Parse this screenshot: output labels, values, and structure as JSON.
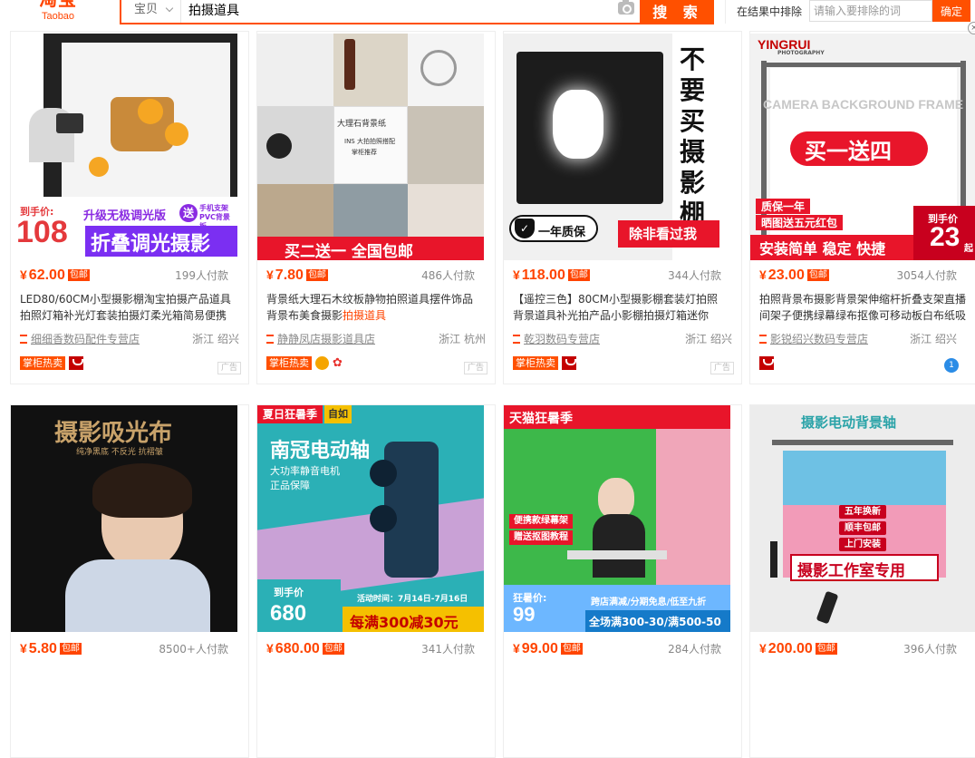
{
  "header": {
    "logo_cn": "淘宝",
    "logo_en": "Taobao",
    "search_category": "宝贝",
    "search_value": "拍摄道具",
    "search_button": "搜 索",
    "exclude_label": "在结果中排除",
    "exclude_placeholder": "请输入要排除的词",
    "exclude_button": "确定"
  },
  "products": [
    {
      "price": "62.00",
      "baoyou": "包邮",
      "deals": "199人付款",
      "title_a": "LED80/60CM小型摄影棚淘宝拍摄产品道具拍照灯箱补光灯套装拍摄灯柔光箱简易便携",
      "title_hl": "",
      "title_b": "",
      "shop": "细细香数码配件专营店",
      "location": "浙江 绍兴",
      "hot_tag": "掌柜热卖",
      "ad": "广告",
      "overlay": {
        "badge": "到手价:",
        "big": "108",
        "upgrade": "升级无极调光版",
        "song": "送",
        "song_sub": "手机支架 PVC背景板",
        "main": "折叠调光摄影"
      }
    },
    {
      "price": "7.80",
      "baoyou": "包邮",
      "deals": "486人付款",
      "title_a": "背景纸大理石木纹板静物拍照道具摆件饰品背景布美食摄影",
      "title_hl": "拍摄道具",
      "title_b": "",
      "shop": "静静凤店摄影道具店",
      "location": "浙江 杭州",
      "hot_tag": "掌柜热卖",
      "ad": "广告",
      "overlay": {
        "card_title": "大理石背景纸",
        "card_sub": "INS 大拍拍照搭配",
        "card_sub2": "掌柜推荐",
        "main": "买二送一 全国包邮"
      }
    },
    {
      "price": "118.00",
      "baoyou": "包邮",
      "deals": "344人付款",
      "title_a": "【遥控三色】80CM小型摄影棚套装灯拍照背景道具补光拍产品小影棚拍摄灯箱迷你",
      "title_hl": "",
      "title_b": "",
      "shop": "乾羽数码专营店",
      "location": "浙江 绍兴",
      "hot_tag": "掌柜热卖",
      "ad": "广告",
      "overlay": {
        "vertical": "不要买摄影棚",
        "quality": "一年质保",
        "main": "除非看过我"
      }
    },
    {
      "price": "23.00",
      "baoyou": "包邮",
      "deals": "3054人付款",
      "title_a": "拍照背景布摄影背景架伸缩杆折叠支架直播间架子便携绿幕绿布抠像可移动板白布纸吸",
      "title_hl": "",
      "title_b": "",
      "shop": "影锐绍兴数码专营店",
      "location": "浙江 绍兴",
      "hot_tag": "",
      "ad": "",
      "overlay": {
        "brand": "YINGRUI",
        "brand_sub": "PHOTOGRAPHY",
        "frame": "CAMERA BACKGROUND FRAME",
        "promo": "买一送四",
        "q1": "质保一年",
        "q2": "晒图送五元红包",
        "main": "安装简单 稳定 快捷",
        "badge": "到手价",
        "big": "23",
        "unit": "起"
      }
    },
    {
      "price": "5.80",
      "baoyou": "包邮",
      "deals": "8500+人付款",
      "overlay": {
        "title": "摄影吸光布",
        "sub": "纯净黑底  不反光  抗褶皱"
      }
    },
    {
      "price": "680.00",
      "baoyou": "包邮",
      "deals": "341人付款",
      "overlay": {
        "tag": "夏日狂暑季",
        "tag2": "自如",
        "title": "南冠电动轴",
        "sub1": "大功率静音电机",
        "sub2": "正品保障",
        "badge": "到手价",
        "big": "680",
        "date": "活动时间：7月14日-7月16日",
        "main": "每满300减30元"
      }
    },
    {
      "price": "99.00",
      "baoyou": "包邮",
      "deals": "284人付款",
      "overlay": {
        "tag": "天猫狂暑季",
        "r1": "便携款绿幕架",
        "r2": "赠送抠图教程",
        "badge": "狂暑价:",
        "big": "99",
        "info": "跨店满减/分期免息/低至九折",
        "main": "全场满300-30/满500-50"
      }
    },
    {
      "price": "200.00",
      "baoyou": "包邮",
      "deals": "396人付款",
      "overlay": {
        "title": "摄影电动背景轴",
        "b1": "五年换新",
        "b2": "顺丰包邮",
        "b3": "上门安装",
        "main": "摄影工作室专用"
      }
    }
  ],
  "colors": {
    "accent": "#ff5000",
    "price": "#ff4400"
  }
}
